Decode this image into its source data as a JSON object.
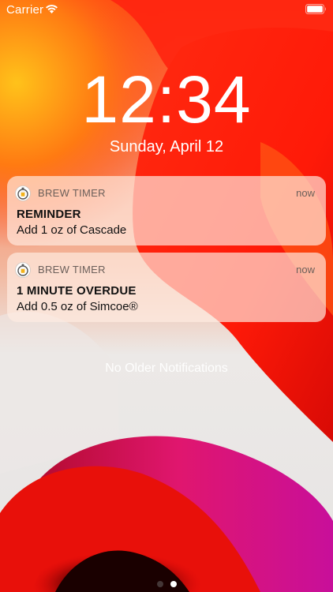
{
  "status_bar": {
    "carrier": "Carrier"
  },
  "lock_screen": {
    "time": "12:34",
    "date": "Sunday, April 12"
  },
  "notifications": [
    {
      "app_name": "BREW TIMER",
      "time": "now",
      "title": "REMINDER",
      "body": "Add 1 oz of Cascade"
    },
    {
      "app_name": "BREW TIMER",
      "time": "now",
      "title": "1 MINUTE OVERDUE",
      "body": "Add 0.5 oz of Simcoe®"
    }
  ],
  "footer": {
    "no_older_text": "No Older Notifications"
  },
  "page_indicator": {
    "count": 2,
    "active_index": 1
  },
  "icons": {
    "wifi": "wifi-icon",
    "battery": "battery-icon",
    "app": "stopwatch-beer-icon"
  },
  "colors": {
    "notification_bg": "#ffece1",
    "wallpaper_red": "#ff1e0f",
    "wallpaper_orange": "#ff9b1a",
    "wallpaper_magenta": "#e3147a"
  }
}
